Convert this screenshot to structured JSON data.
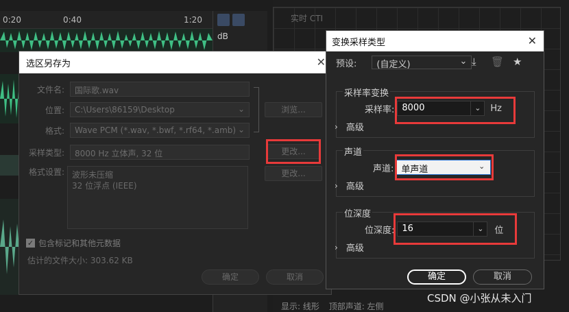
{
  "editor": {
    "timeline": [
      "0:20",
      "0:40",
      "1:20"
    ],
    "db_label": "dB",
    "cti_label": "实时 CTI",
    "status": [
      "显示: 线形",
      "顶部声道: 左侧"
    ]
  },
  "save_dialog": {
    "title": "选区另存为",
    "fields": {
      "filename_label": "文件名:",
      "filename_value": "国际歌.wav",
      "location_label": "位置:",
      "location_value": "C:\\Users\\86159\\Desktop",
      "format_label": "格式:",
      "format_value": "Wave PCM (*.wav, *.bwf, *.rf64, *.amb)",
      "sample_type_label": "采样类型:",
      "sample_type_value": "8000 Hz 立体声, 32 位",
      "format_settings_label": "格式设置:",
      "format_settings_lines": [
        "波形未压缩",
        "32 位浮点 (IEEE)"
      ]
    },
    "browse_button": "浏览...",
    "change_button": "更改...",
    "change_button_2": "更改...",
    "include_markers": "包含标记和其他元数据",
    "estimated_size": "估计的文件大小: 303.62 KB",
    "ok_button": "确定",
    "cancel_button": "取消"
  },
  "convert_dialog": {
    "title": "变换采样类型",
    "preset_label": "预设:",
    "preset_value": "(自定义)",
    "sample_rate_group": "采样率变换",
    "sample_rate_label": "采样率:",
    "sample_rate_value": "8000",
    "sample_rate_unit": "Hz",
    "advanced_1": "高级",
    "channels_group": "声道",
    "channels_label": "声道:",
    "channels_value": "单声道",
    "advanced_2": "高级",
    "bit_depth_group": "位深度",
    "bit_depth_label": "位深度:",
    "bit_depth_value": "16",
    "bit_depth_unit": "位",
    "advanced_3": "高级",
    "ok_button": "确定",
    "cancel_button": "取消"
  },
  "watermark": "CSDN @小张从未入门",
  "colors": {
    "highlight": "#e83a3a",
    "wave": "#3fbf84",
    "focus": "#2f78d8"
  }
}
